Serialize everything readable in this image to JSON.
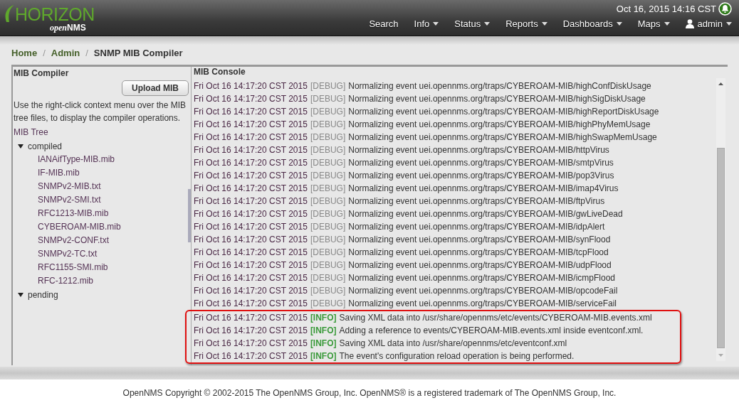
{
  "header": {
    "logo": {
      "title": "HORIZON",
      "subtitle_italic": "open",
      "subtitle_bold": "NMS"
    },
    "datetime": "Oct 16, 2015 14:16 CST",
    "nav": [
      {
        "label": "Search",
        "dropdown": false,
        "kind": "link"
      },
      {
        "label": "Info",
        "dropdown": true,
        "kind": "link"
      },
      {
        "label": "Status",
        "dropdown": true,
        "kind": "link"
      },
      {
        "label": "Reports",
        "dropdown": true,
        "kind": "link"
      },
      {
        "label": "Dashboards",
        "dropdown": true,
        "kind": "link"
      },
      {
        "label": "Maps",
        "dropdown": true,
        "kind": "link"
      },
      {
        "label": "admin",
        "dropdown": true,
        "kind": "user"
      }
    ]
  },
  "breadcrumb": [
    {
      "label": "Home",
      "link": true
    },
    {
      "separator": "/",
      "label": "Admin",
      "link": true
    },
    {
      "separator": "/",
      "label": "SNMP MIB Compiler",
      "link": false
    }
  ],
  "compiler": {
    "title": "MIB Compiler",
    "upload_button": "Upload MIB",
    "help": "Use the right-click context menu over the MIB tree files, to display the compiler operations.",
    "tree_title": "MIB Tree",
    "tree": [
      {
        "label": "compiled",
        "expanded": true,
        "children": [
          {
            "label": "IANAifType-MIB.mib"
          },
          {
            "label": "IF-MIB.mib"
          },
          {
            "label": "SNMPv2-MIB.txt"
          },
          {
            "label": "SNMPv2-SMI.txt"
          },
          {
            "label": "RFC1213-MIB.mib"
          },
          {
            "label": "CYBEROAM-MIB.mib"
          },
          {
            "label": "SNMPv2-CONF.txt"
          },
          {
            "label": "SNMPv2-TC.txt"
          },
          {
            "label": "RFC1155-SMI.mib"
          },
          {
            "label": "RFC-1212.mib"
          }
        ]
      },
      {
        "label": "pending",
        "expanded": true
      }
    ]
  },
  "console": {
    "title": "MIB Console",
    "entries": [
      {
        "time": "Fri Oct 16 14:17:20 CST 2015",
        "level": "[DEBUG]",
        "kind": "debug",
        "message": "Normalizing event uei.opennms.org/traps/CYBEROAM-MIB/highConfDiskUsage",
        "highlighted": false
      },
      {
        "time": "Fri Oct 16 14:17:20 CST 2015",
        "level": "[DEBUG]",
        "kind": "debug",
        "message": "Normalizing event uei.opennms.org/traps/CYBEROAM-MIB/highSigDiskUsage",
        "highlighted": false
      },
      {
        "time": "Fri Oct 16 14:17:20 CST 2015",
        "level": "[DEBUG]",
        "kind": "debug",
        "message": "Normalizing event uei.opennms.org/traps/CYBEROAM-MIB/highReportDiskUsage",
        "highlighted": false
      },
      {
        "time": "Fri Oct 16 14:17:20 CST 2015",
        "level": "[DEBUG]",
        "kind": "debug",
        "message": "Normalizing event uei.opennms.org/traps/CYBEROAM-MIB/highPhyMemUsage",
        "highlighted": false
      },
      {
        "time": "Fri Oct 16 14:17:20 CST 2015",
        "level": "[DEBUG]",
        "kind": "debug",
        "message": "Normalizing event uei.opennms.org/traps/CYBEROAM-MIB/highSwapMemUsage",
        "highlighted": false
      },
      {
        "time": "Fri Oct 16 14:17:20 CST 2015",
        "level": "[DEBUG]",
        "kind": "debug",
        "message": "Normalizing event uei.opennms.org/traps/CYBEROAM-MIB/httpVirus",
        "highlighted": false
      },
      {
        "time": "Fri Oct 16 14:17:20 CST 2015",
        "level": "[DEBUG]",
        "kind": "debug",
        "message": "Normalizing event uei.opennms.org/traps/CYBEROAM-MIB/smtpVirus",
        "highlighted": false
      },
      {
        "time": "Fri Oct 16 14:17:20 CST 2015",
        "level": "[DEBUG]",
        "kind": "debug",
        "message": "Normalizing event uei.opennms.org/traps/CYBEROAM-MIB/pop3Virus",
        "highlighted": false
      },
      {
        "time": "Fri Oct 16 14:17:20 CST 2015",
        "level": "[DEBUG]",
        "kind": "debug",
        "message": "Normalizing event uei.opennms.org/traps/CYBEROAM-MIB/imap4Virus",
        "highlighted": false
      },
      {
        "time": "Fri Oct 16 14:17:20 CST 2015",
        "level": "[DEBUG]",
        "kind": "debug",
        "message": "Normalizing event uei.opennms.org/traps/CYBEROAM-MIB/ftpVirus",
        "highlighted": false
      },
      {
        "time": "Fri Oct 16 14:17:20 CST 2015",
        "level": "[DEBUG]",
        "kind": "debug",
        "message": "Normalizing event uei.opennms.org/traps/CYBEROAM-MIB/gwLiveDead",
        "highlighted": false
      },
      {
        "time": "Fri Oct 16 14:17:20 CST 2015",
        "level": "[DEBUG]",
        "kind": "debug",
        "message": "Normalizing event uei.opennms.org/traps/CYBEROAM-MIB/idpAlert",
        "highlighted": false
      },
      {
        "time": "Fri Oct 16 14:17:20 CST 2015",
        "level": "[DEBUG]",
        "kind": "debug",
        "message": "Normalizing event uei.opennms.org/traps/CYBEROAM-MIB/synFlood",
        "highlighted": false
      },
      {
        "time": "Fri Oct 16 14:17:20 CST 2015",
        "level": "[DEBUG]",
        "kind": "debug",
        "message": "Normalizing event uei.opennms.org/traps/CYBEROAM-MIB/tcpFlood",
        "highlighted": false
      },
      {
        "time": "Fri Oct 16 14:17:20 CST 2015",
        "level": "[DEBUG]",
        "kind": "debug",
        "message": "Normalizing event uei.opennms.org/traps/CYBEROAM-MIB/udpFlood",
        "highlighted": false
      },
      {
        "time": "Fri Oct 16 14:17:20 CST 2015",
        "level": "[DEBUG]",
        "kind": "debug",
        "message": "Normalizing event uei.opennms.org/traps/CYBEROAM-MIB/icmpFlood",
        "highlighted": false
      },
      {
        "time": "Fri Oct 16 14:17:20 CST 2015",
        "level": "[DEBUG]",
        "kind": "debug",
        "message": "Normalizing event uei.opennms.org/traps/CYBEROAM-MIB/opcodeFail",
        "highlighted": false
      },
      {
        "time": "Fri Oct 16 14:17:20 CST 2015",
        "level": "[DEBUG]",
        "kind": "debug",
        "message": "Normalizing event uei.opennms.org/traps/CYBEROAM-MIB/serviceFail",
        "highlighted": false
      },
      {
        "time": "Fri Oct 16 14:17:20 CST 2015",
        "level": "[INFO]",
        "kind": "info",
        "message": "Saving XML data into /usr/share/opennms/etc/events/CYBEROAM-MIB.events.xml",
        "highlighted": true
      },
      {
        "time": "Fri Oct 16 14:17:20 CST 2015",
        "level": "[INFO]",
        "kind": "info",
        "message": "Adding a reference to events/CYBEROAM-MIB.events.xml inside eventconf.xml.",
        "highlighted": true
      },
      {
        "time": "Fri Oct 16 14:17:20 CST 2015",
        "level": "[INFO]",
        "kind": "info",
        "message": "Saving XML data into /usr/share/opennms/etc/eventconf.xml",
        "highlighted": true
      },
      {
        "time": "Fri Oct 16 14:17:20 CST 2015",
        "level": "[INFO]",
        "kind": "info",
        "message": "The event's configuration reload operation is being performed.",
        "highlighted": true
      }
    ]
  },
  "footer": "OpenNMS Copyright © 2002-2015 The OpenNMS Group, Inc. OpenNMS® is a registered trademark of The OpenNMS Group, Inc."
}
